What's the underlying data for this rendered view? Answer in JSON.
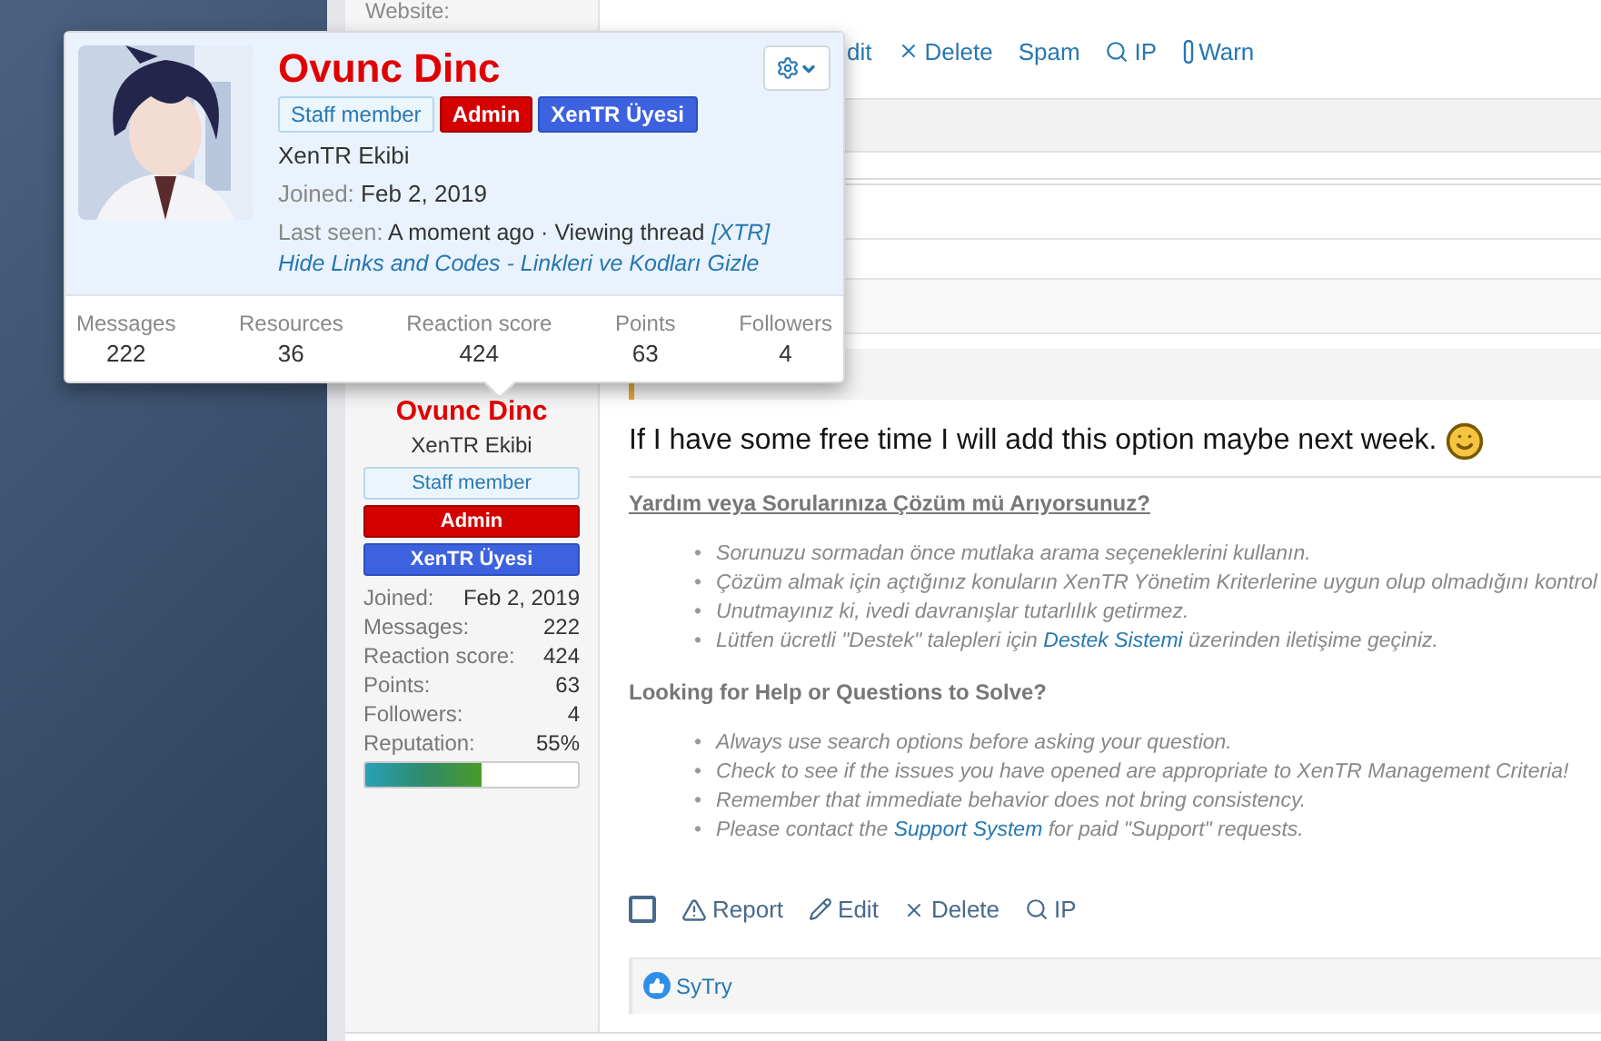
{
  "top_post": {
    "website_label": "Website:",
    "actions": [
      {
        "label": "dit",
        "kind": "plain"
      },
      {
        "label": "Delete",
        "kind": "delete"
      },
      {
        "label": "Spam",
        "kind": "plain"
      },
      {
        "label": "IP",
        "kind": "ip"
      },
      {
        "label": "Warn",
        "kind": "warn"
      }
    ]
  },
  "popup": {
    "name": "Ovunc Dinc",
    "banners": [
      {
        "label": "Staff member",
        "kind": "staff"
      },
      {
        "label": "Admin",
        "kind": "admin"
      },
      {
        "label": "XenTR Üyesi",
        "kind": "member"
      }
    ],
    "title": "XenTR Ekibi",
    "joined_label": "Joined:",
    "joined_value": "Feb 2, 2019",
    "last_seen_label": "Last seen:",
    "last_seen_value": "A moment ago · Viewing thread",
    "thread_link_lines": [
      "[XTR]",
      "Hide Links and Codes - Linkleri ve Kodları Gizle"
    ],
    "stats": [
      {
        "label": "Messages",
        "value": "222"
      },
      {
        "label": "Resources",
        "value": "36"
      },
      {
        "label": "Reaction score",
        "value": "424"
      },
      {
        "label": "Points",
        "value": "63"
      },
      {
        "label": "Followers",
        "value": "4"
      }
    ]
  },
  "user_cell": {
    "name": "Ovunc Dinc",
    "title": "XenTR Ekibi",
    "banners": [
      {
        "label": "Staff member",
        "kind": "staff"
      },
      {
        "label": "Admin",
        "kind": "admin"
      },
      {
        "label": "XenTR Üyesi",
        "kind": "member"
      }
    ],
    "stats": [
      {
        "label": "Joined:",
        "value": "Feb 2, 2019"
      },
      {
        "label": "Messages:",
        "value": "222"
      },
      {
        "label": "Reaction score:",
        "value": "424"
      },
      {
        "label": "Points:",
        "value": "63"
      },
      {
        "label": "Followers:",
        "value": "4"
      },
      {
        "label": "Reputation:",
        "value": "55%"
      }
    ],
    "reputation": {
      "level": 0.55
    }
  },
  "post": {
    "message": "If I have some free time I will add this option maybe next week.",
    "tr_heading": "Yardım veya Sorularınıza Çözüm mü Arıyorsunuz?",
    "tr_items": [
      {
        "bullet": "•",
        "text": "Sorunuzu sormadan önce mutlaka arama seçeneklerini kullanın."
      },
      {
        "bullet": "•",
        "text": "Çözüm almak için açtığınız konuların XenTR Yönetim Kriterlerine uygun olup olmadığını kontrol"
      },
      {
        "bullet": "•",
        "text": "Unutmayınız ki, ivedi davranışlar tutarlılık getirmez."
      },
      {
        "bullet": "•",
        "text": "Lütfen ücretli \"Destek\" talepleri için ",
        "link": "Destek Sistemi",
        "after": " üzerinden iletişime geçiniz."
      }
    ],
    "en_heading": "Looking for Help or Questions to Solve?",
    "en_items": [
      {
        "bullet": "•",
        "text": "Always use search options before asking your question."
      },
      {
        "bullet": "•",
        "text": "Check to see if the issues you have opened are appropriate to XenTR Management Criteria!"
      },
      {
        "bullet": "•",
        "text": "Remember that immediate behavior does not bring consistency."
      },
      {
        "bullet": "•",
        "text": "Please contact the ",
        "link": "Support System",
        "after": " for paid \"Support\" requests."
      }
    ],
    "checked": false,
    "actions": [
      {
        "label": "Report",
        "kind": "report"
      },
      {
        "label": "Edit",
        "kind": "edit"
      },
      {
        "label": "Delete",
        "kind": "delete"
      },
      {
        "label": "IP",
        "kind": "ip"
      }
    ],
    "reaction_user": "SyTry"
  }
}
